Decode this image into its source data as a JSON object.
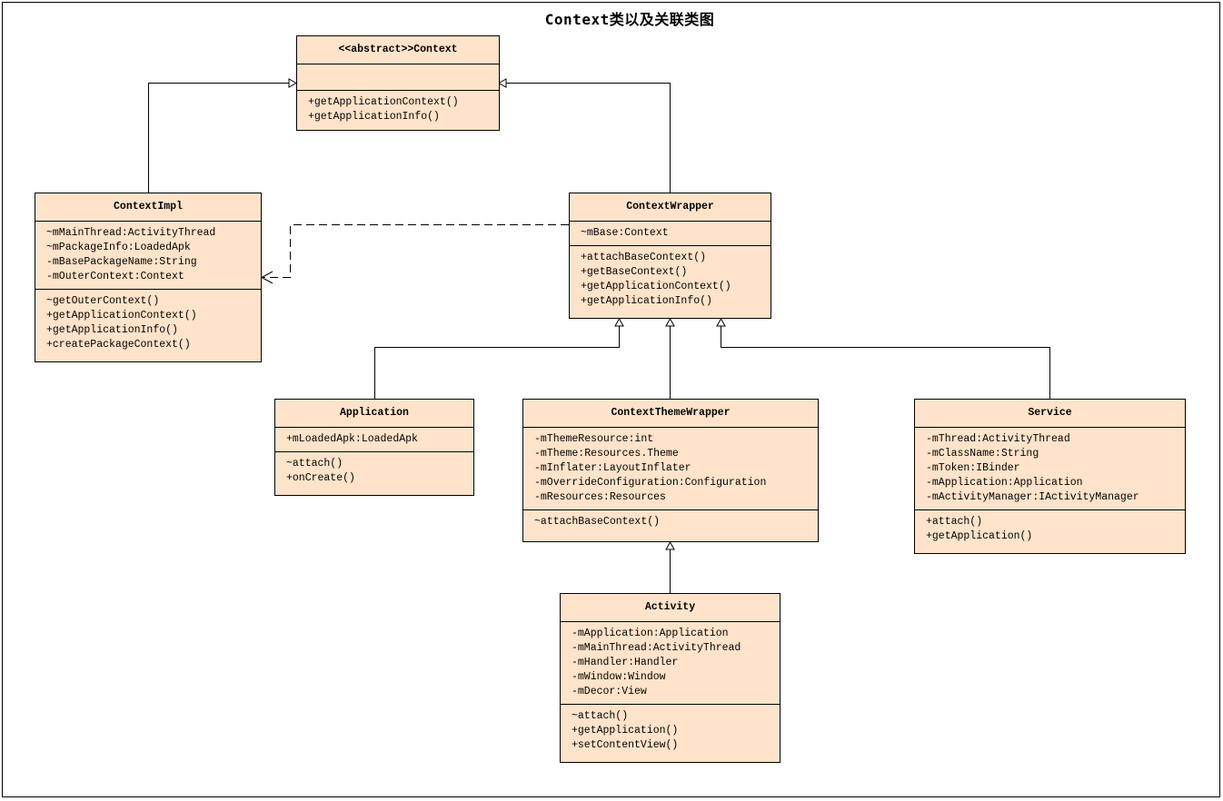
{
  "diagram": {
    "title": "Context类以及关联类图",
    "classes": {
      "context": {
        "name": "<<abstract>>Context",
        "attributes": [],
        "methods": [
          "+getApplicationContext()",
          "+getApplicationInfo()"
        ]
      },
      "contextimpl": {
        "name": "ContextImpl",
        "attributes": [
          "~mMainThread:ActivityThread",
          "~mPackageInfo:LoadedApk",
          "-mBasePackageName:String",
          "-mOuterContext:Context"
        ],
        "methods": [
          "~getOuterContext()",
          "+getApplicationContext()",
          "+getApplicationInfo()",
          "+createPackageContext()"
        ]
      },
      "contextwrapper": {
        "name": "ContextWrapper",
        "attributes": [
          "~mBase:Context"
        ],
        "methods": [
          "+attachBaseContext()",
          "+getBaseContext()",
          "+getApplicationContext()",
          "+getApplicationInfo()"
        ]
      },
      "application": {
        "name": "Application",
        "attributes": [
          "+mLoadedApk:LoadedApk"
        ],
        "methods": [
          "~attach()",
          "+onCreate()"
        ]
      },
      "contextthemewrapper": {
        "name": "ContextThemeWrapper",
        "attributes": [
          "-mThemeResource:int",
          "-mTheme:Resources.Theme",
          "-mInflater:LayoutInflater",
          "-mOverrideConfiguration:Configuration",
          "-mResources:Resources"
        ],
        "methods": [
          "~attachBaseContext()"
        ]
      },
      "service": {
        "name": "Service",
        "attributes": [
          "-mThread:ActivityThread",
          "-mClassName:String",
          "-mToken:IBinder",
          "-mApplication:Application",
          "-mActivityManager:IActivityManager"
        ],
        "methods": [
          "+attach()",
          "+getApplication()"
        ]
      },
      "activity": {
        "name": "Activity",
        "attributes": [
          "-mApplication:Application",
          "-mMainThread:ActivityThread",
          "-mHandler:Handler",
          "-mWindow:Window",
          "-mDecor:View"
        ],
        "methods": [
          "~attach()",
          "+getApplication()",
          "+setContentView()"
        ]
      }
    },
    "relations": [
      {
        "type": "generalization",
        "from": "ContextImpl",
        "to": "<<abstract>>Context"
      },
      {
        "type": "generalization",
        "from": "ContextWrapper",
        "to": "<<abstract>>Context"
      },
      {
        "type": "dependency",
        "from": "ContextWrapper",
        "to": "ContextImpl"
      },
      {
        "type": "generalization",
        "from": "Application",
        "to": "ContextWrapper"
      },
      {
        "type": "generalization",
        "from": "ContextThemeWrapper",
        "to": "ContextWrapper"
      },
      {
        "type": "generalization",
        "from": "Service",
        "to": "ContextWrapper"
      },
      {
        "type": "generalization",
        "from": "Activity",
        "to": "ContextThemeWrapper"
      }
    ],
    "colors": {
      "class_fill": "#ffe3ca",
      "line": "#000000",
      "background": "#ffffff"
    }
  }
}
